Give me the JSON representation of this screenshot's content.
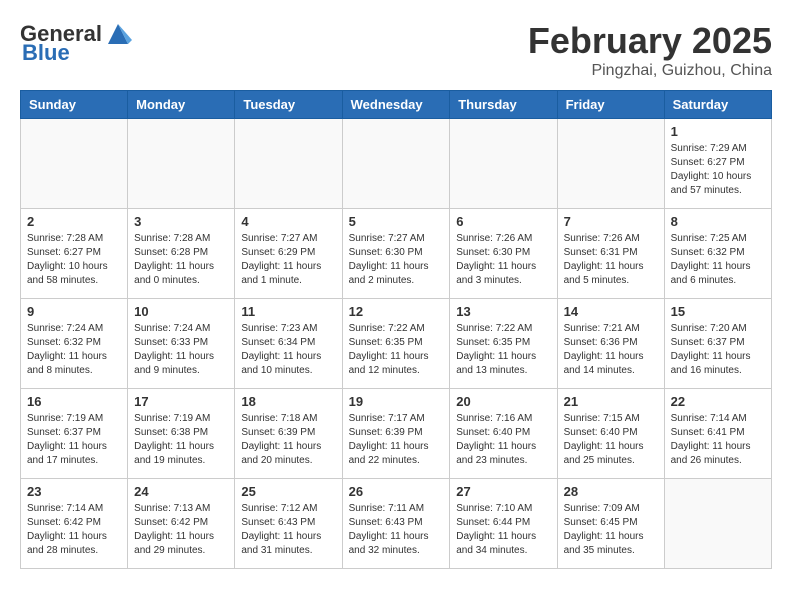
{
  "header": {
    "logo_general": "General",
    "logo_blue": "Blue",
    "main_title": "February 2025",
    "subtitle": "Pingzhai, Guizhou, China"
  },
  "days_of_week": [
    "Sunday",
    "Monday",
    "Tuesday",
    "Wednesday",
    "Thursday",
    "Friday",
    "Saturday"
  ],
  "weeks": [
    [
      {
        "day": "",
        "info": ""
      },
      {
        "day": "",
        "info": ""
      },
      {
        "day": "",
        "info": ""
      },
      {
        "day": "",
        "info": ""
      },
      {
        "day": "",
        "info": ""
      },
      {
        "day": "",
        "info": ""
      },
      {
        "day": "1",
        "info": "Sunrise: 7:29 AM\nSunset: 6:27 PM\nDaylight: 10 hours and 57 minutes."
      }
    ],
    [
      {
        "day": "2",
        "info": "Sunrise: 7:28 AM\nSunset: 6:27 PM\nDaylight: 10 hours and 58 minutes."
      },
      {
        "day": "3",
        "info": "Sunrise: 7:28 AM\nSunset: 6:28 PM\nDaylight: 11 hours and 0 minutes."
      },
      {
        "day": "4",
        "info": "Sunrise: 7:27 AM\nSunset: 6:29 PM\nDaylight: 11 hours and 1 minute."
      },
      {
        "day": "5",
        "info": "Sunrise: 7:27 AM\nSunset: 6:30 PM\nDaylight: 11 hours and 2 minutes."
      },
      {
        "day": "6",
        "info": "Sunrise: 7:26 AM\nSunset: 6:30 PM\nDaylight: 11 hours and 3 minutes."
      },
      {
        "day": "7",
        "info": "Sunrise: 7:26 AM\nSunset: 6:31 PM\nDaylight: 11 hours and 5 minutes."
      },
      {
        "day": "8",
        "info": "Sunrise: 7:25 AM\nSunset: 6:32 PM\nDaylight: 11 hours and 6 minutes."
      }
    ],
    [
      {
        "day": "9",
        "info": "Sunrise: 7:24 AM\nSunset: 6:32 PM\nDaylight: 11 hours and 8 minutes."
      },
      {
        "day": "10",
        "info": "Sunrise: 7:24 AM\nSunset: 6:33 PM\nDaylight: 11 hours and 9 minutes."
      },
      {
        "day": "11",
        "info": "Sunrise: 7:23 AM\nSunset: 6:34 PM\nDaylight: 11 hours and 10 minutes."
      },
      {
        "day": "12",
        "info": "Sunrise: 7:22 AM\nSunset: 6:35 PM\nDaylight: 11 hours and 12 minutes."
      },
      {
        "day": "13",
        "info": "Sunrise: 7:22 AM\nSunset: 6:35 PM\nDaylight: 11 hours and 13 minutes."
      },
      {
        "day": "14",
        "info": "Sunrise: 7:21 AM\nSunset: 6:36 PM\nDaylight: 11 hours and 14 minutes."
      },
      {
        "day": "15",
        "info": "Sunrise: 7:20 AM\nSunset: 6:37 PM\nDaylight: 11 hours and 16 minutes."
      }
    ],
    [
      {
        "day": "16",
        "info": "Sunrise: 7:19 AM\nSunset: 6:37 PM\nDaylight: 11 hours and 17 minutes."
      },
      {
        "day": "17",
        "info": "Sunrise: 7:19 AM\nSunset: 6:38 PM\nDaylight: 11 hours and 19 minutes."
      },
      {
        "day": "18",
        "info": "Sunrise: 7:18 AM\nSunset: 6:39 PM\nDaylight: 11 hours and 20 minutes."
      },
      {
        "day": "19",
        "info": "Sunrise: 7:17 AM\nSunset: 6:39 PM\nDaylight: 11 hours and 22 minutes."
      },
      {
        "day": "20",
        "info": "Sunrise: 7:16 AM\nSunset: 6:40 PM\nDaylight: 11 hours and 23 minutes."
      },
      {
        "day": "21",
        "info": "Sunrise: 7:15 AM\nSunset: 6:40 PM\nDaylight: 11 hours and 25 minutes."
      },
      {
        "day": "22",
        "info": "Sunrise: 7:14 AM\nSunset: 6:41 PM\nDaylight: 11 hours and 26 minutes."
      }
    ],
    [
      {
        "day": "23",
        "info": "Sunrise: 7:14 AM\nSunset: 6:42 PM\nDaylight: 11 hours and 28 minutes."
      },
      {
        "day": "24",
        "info": "Sunrise: 7:13 AM\nSunset: 6:42 PM\nDaylight: 11 hours and 29 minutes."
      },
      {
        "day": "25",
        "info": "Sunrise: 7:12 AM\nSunset: 6:43 PM\nDaylight: 11 hours and 31 minutes."
      },
      {
        "day": "26",
        "info": "Sunrise: 7:11 AM\nSunset: 6:43 PM\nDaylight: 11 hours and 32 minutes."
      },
      {
        "day": "27",
        "info": "Sunrise: 7:10 AM\nSunset: 6:44 PM\nDaylight: 11 hours and 34 minutes."
      },
      {
        "day": "28",
        "info": "Sunrise: 7:09 AM\nSunset: 6:45 PM\nDaylight: 11 hours and 35 minutes."
      },
      {
        "day": "",
        "info": ""
      }
    ]
  ]
}
